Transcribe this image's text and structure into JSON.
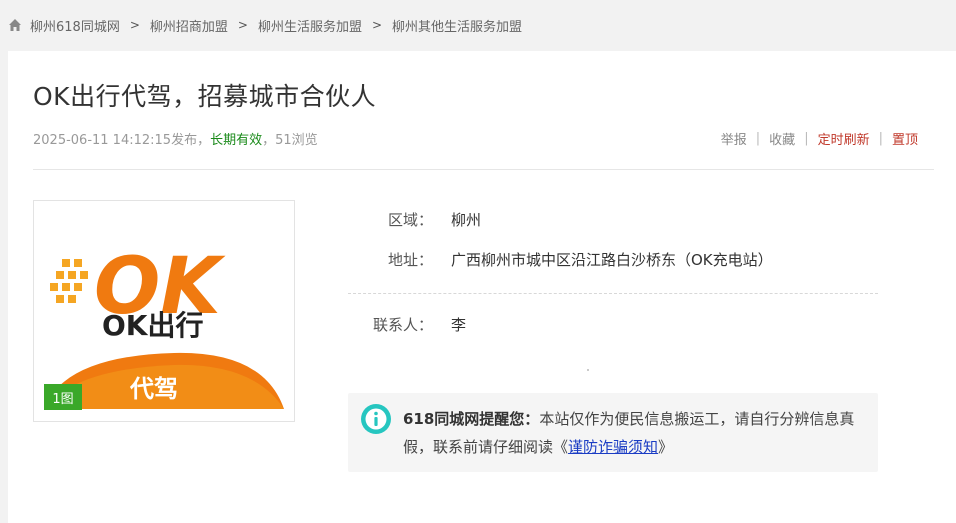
{
  "breadcrumb": {
    "items": [
      "柳州618同城网",
      "柳州招商加盟",
      "柳州生活服务加盟",
      "柳州其他生活服务加盟"
    ],
    "separator": ">"
  },
  "post": {
    "title": "OK出行代驾，招募城市合伙人",
    "published": "2025-06-11 14:12:15发布",
    "comma1": "，",
    "validity": "长期有效",
    "comma2": "，",
    "views": "51浏览"
  },
  "actions": {
    "report": "举报",
    "favorite": "收藏",
    "scheduled_refresh": "定时刷新",
    "pin_top": "置顶",
    "separator": "|"
  },
  "photo": {
    "count_label": "1图",
    "logo_big": "OK",
    "logo_brand": "OK出行",
    "logo_service": "代驾"
  },
  "details": {
    "region_label": "区域：",
    "region_value": "柳州",
    "address_label": "地址：",
    "address_value": "广西柳州市城中区沿江路白沙桥东（OK充电站）",
    "contact_label": "联系人：",
    "contact_value": "李"
  },
  "notice": {
    "heading": "618同城网提醒您：",
    "body": "本站仅作为便民信息搬运工，请自行分辨信息真假，联系前请仔细阅读",
    "link_open": "《",
    "link_text": "谨防诈骗须知",
    "link_close": "》"
  },
  "colors": {
    "validity_green": "#1a8a1a",
    "action_red": "#c0392b",
    "badge_green": "#3aa829",
    "info_teal": "#26c6c0",
    "logo_orange": "#f07a10"
  }
}
